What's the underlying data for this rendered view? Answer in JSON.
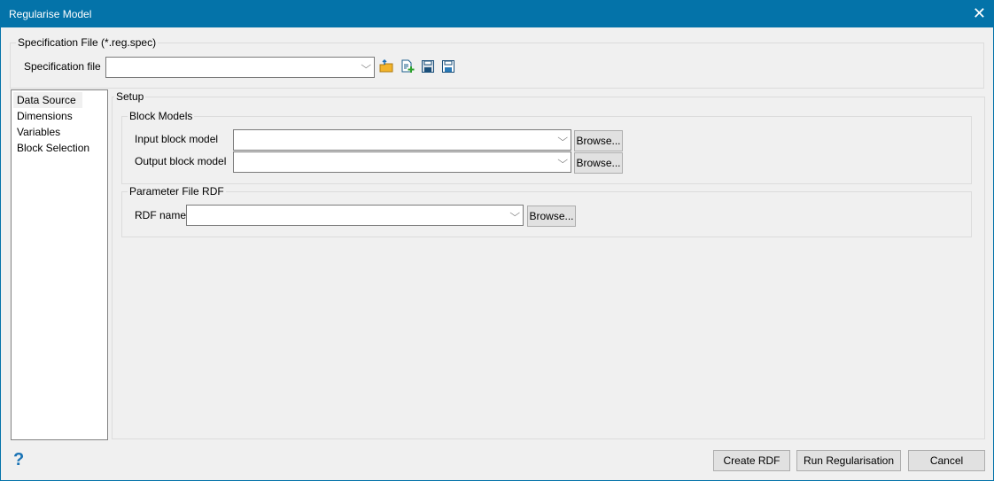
{
  "window": {
    "title": "Regularise Model",
    "close_icon": "close-icon"
  },
  "spec": {
    "legend": "Specification File (*.reg.spec)",
    "label": "Specification file",
    "value": "",
    "icons": [
      "open-folder-icon",
      "new-file-icon",
      "save-icon",
      "save-as-icon"
    ]
  },
  "nav": {
    "items": [
      "Data Source",
      "Dimensions",
      "Variables",
      "Block Selection"
    ]
  },
  "setup": {
    "legend": "Setup",
    "block_models": {
      "legend": "Block Models",
      "input_label": "Input block model",
      "input_value": "",
      "output_label": "Output block model",
      "output_value": "",
      "browse": "Browse..."
    },
    "rdf": {
      "legend": "Parameter File RDF",
      "label": "RDF name",
      "value": "",
      "browse": "Browse..."
    }
  },
  "footer": {
    "help": "?",
    "create_rdf": "Create RDF",
    "run": "Run Regularisation",
    "cancel": "Cancel"
  }
}
